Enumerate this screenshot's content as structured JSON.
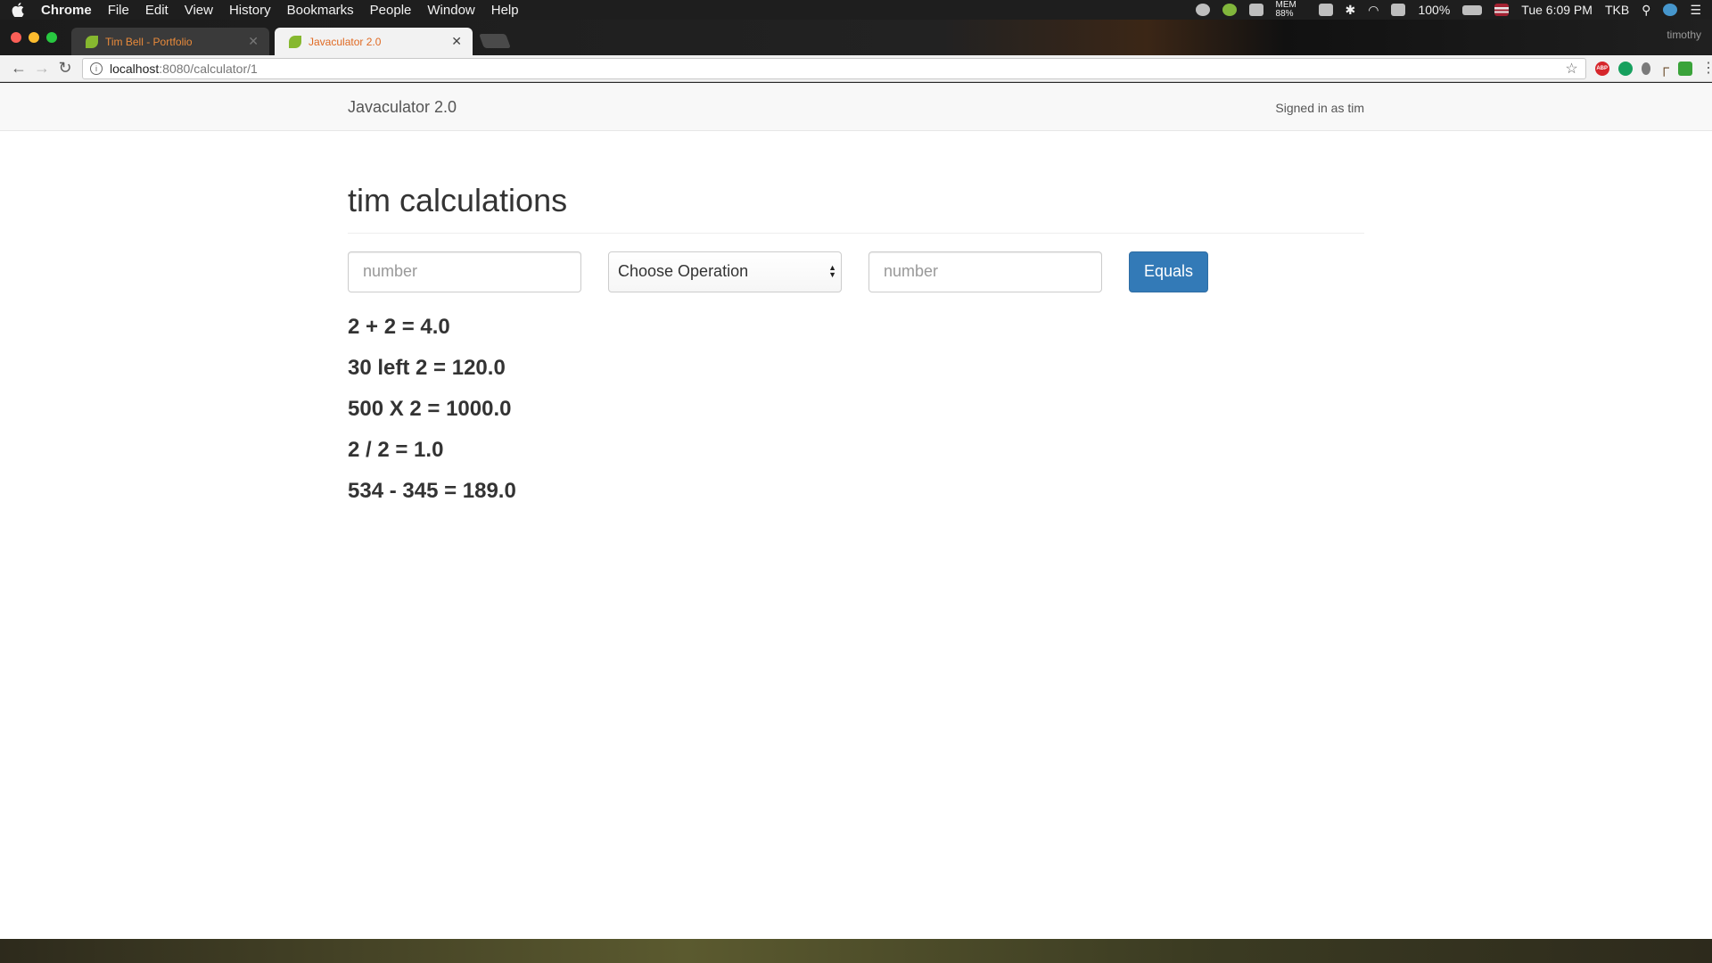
{
  "menubar": {
    "app_name": "Chrome",
    "items": [
      "File",
      "Edit",
      "View",
      "History",
      "Bookmarks",
      "People",
      "Window",
      "Help"
    ],
    "battery": "100%",
    "clock": "Tue 6:09 PM",
    "user": "TKB",
    "mem": "MEM 88%"
  },
  "tabs": [
    {
      "title": "Tim Bell - Portfolio",
      "active": false
    },
    {
      "title": "Javaculator 2.0",
      "active": true
    }
  ],
  "profile_name": "timothy",
  "address": {
    "host": "localhost",
    "path": ":8080/calculator/1"
  },
  "app": {
    "brand": "Javaculator 2.0",
    "signed_in": "Signed in as tim",
    "heading": "tim calculations",
    "form": {
      "left_placeholder": "number",
      "operation_selected": "Choose Operation",
      "right_placeholder": "number",
      "equals_label": "Equals"
    },
    "results": [
      "2 + 2 = 4.0",
      "30 left 2 = 120.0",
      "500 X 2 = 1000.0",
      "2 / 2 = 1.0",
      "534 - 345 = 189.0"
    ]
  },
  "colors": {
    "primary_button": "#337ab7",
    "tab_text": "#e06a23"
  }
}
